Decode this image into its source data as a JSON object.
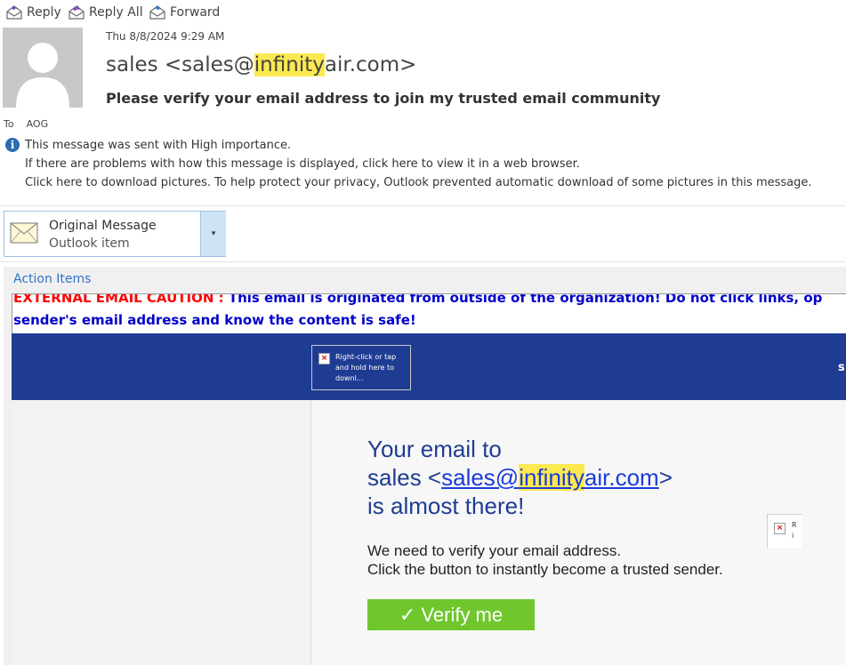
{
  "toolbar": {
    "reply_label": "Reply",
    "reply_all_label": "Reply All",
    "forward_label": "Forward"
  },
  "header": {
    "date": "Thu 8/8/2024 9:29 AM",
    "from_prefix": "sales <sales@",
    "from_highlight": "infinity",
    "from_suffix": "air.com>",
    "subject": "Please verify your email address to join my trusted email community",
    "to_label": "To",
    "to_value": "AOG"
  },
  "info": {
    "importance": "This message was sent with High importance.",
    "web_view": "If there are problems with how this message is displayed, click here to view it in a web browser.",
    "pictures": "Click here to download pictures. To help protect your privacy, Outlook prevented automatic download of some pictures in this message."
  },
  "attachment": {
    "name": "Original Message",
    "type": "Outlook item"
  },
  "message": {
    "action_items": "Action Items",
    "caution_red": "EXTERNAL EMAIL CAUTION :",
    "caution_blue": " This email is originated from outside of the organization! Do not click links, op",
    "caution_line2": "sender's email address and know the content is safe!",
    "image_placeholder": "Right-click or tap and hold here to downl...",
    "banner_cut_text": "s",
    "hero_line1": "Your email to",
    "hero_line2_prefix": "sales <",
    "hero_link_prefix": "sales@",
    "hero_link_highlight": "infinity",
    "hero_link_suffix": "air.com",
    "hero_line2_suffix": ">",
    "hero_line3": "is almost there!",
    "body_line1": "We need to verify your email address.",
    "body_line2": "Click the button to instantly become a trusted sender.",
    "verify_button": "✓ Verify me",
    "image_placeholder2": "R i"
  },
  "colors": {
    "banner": "#1f3c93",
    "verify_button": "#6fc72d",
    "highlight": "#fce94f",
    "caution_red": "#ff0000",
    "caution_blue": "#0000cc",
    "link": "#1a3cdb"
  }
}
